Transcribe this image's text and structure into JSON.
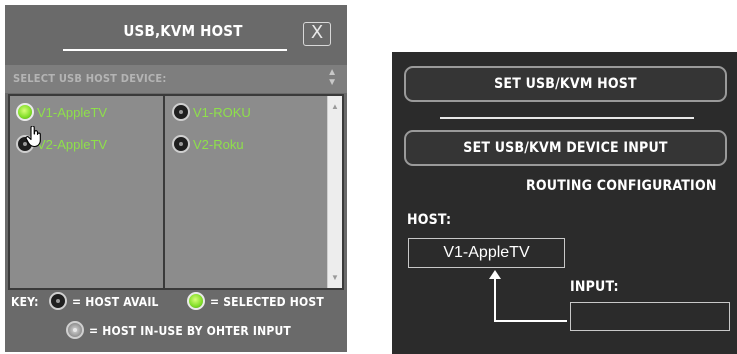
{
  "left_panel": {
    "title": "USB,KVM HOST",
    "close_label": "X",
    "select_label": "SELECT USB HOST DEVICE:",
    "devices": [
      {
        "label": "V1-AppleTV",
        "state": "selected"
      },
      {
        "label": "V1-ROKU",
        "state": "available"
      },
      {
        "label": "V2-AppleTV",
        "state": "available"
      },
      {
        "label": "V2-Roku",
        "state": "available"
      }
    ],
    "key": {
      "prefix": "KEY:",
      "host_avail": "= HOST AVAIL",
      "selected_host": "= SELECTED HOST",
      "host_in_use": "= HOST IN-USE BY OHTER INPUT"
    }
  },
  "right_panel": {
    "set_host_button": "SET USB/KVM HOST",
    "set_device_input_button": "SET USB/KVM DEVICE INPUT",
    "routing_title": "ROUTING CONFIGURATION",
    "host_label": "HOST:",
    "host_value": "V1-AppleTV",
    "input_label": "INPUT:",
    "input_value": ""
  },
  "colors": {
    "device_text": "#8ee04a",
    "left_bg": "#6a6a6a",
    "right_bg": "#2b2b2b"
  }
}
